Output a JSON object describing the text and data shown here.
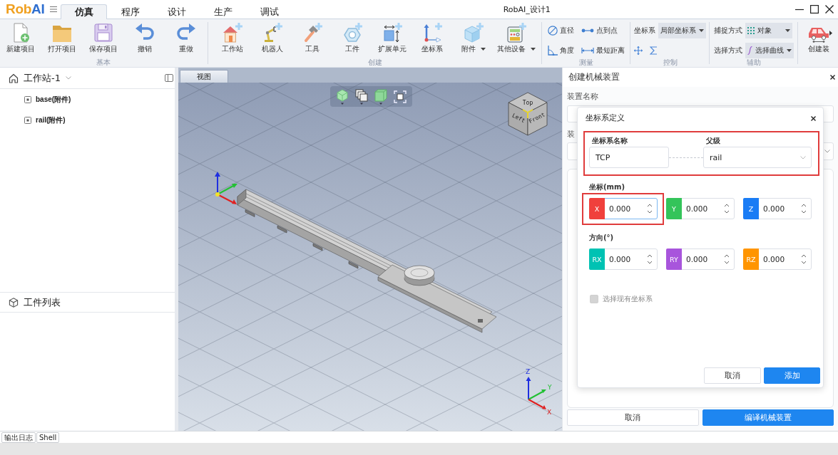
{
  "app": {
    "logo": [
      "Rob",
      "AI"
    ],
    "title": "RobAI_设计1"
  },
  "tabs": [
    {
      "label": "仿真",
      "selected": true
    },
    {
      "label": "程序",
      "selected": false
    },
    {
      "label": "设计",
      "selected": false
    },
    {
      "label": "生产",
      "selected": false
    },
    {
      "label": "调试",
      "selected": false
    }
  ],
  "ribbon": {
    "groups": [
      {
        "label": "基本",
        "items": [
          {
            "kind": "large",
            "label": "新建项目"
          },
          {
            "kind": "large",
            "label": "打开项目"
          },
          {
            "kind": "large",
            "label": "保存项目"
          },
          {
            "kind": "large",
            "label": "撤销"
          },
          {
            "kind": "large",
            "label": "重做"
          }
        ]
      },
      {
        "label": "创建",
        "items": [
          {
            "kind": "large",
            "label": "工作站"
          },
          {
            "kind": "large",
            "label": "机器人"
          },
          {
            "kind": "large",
            "label": "工具"
          },
          {
            "kind": "large",
            "label": "工件"
          },
          {
            "kind": "large",
            "label": "扩展单元"
          },
          {
            "kind": "large",
            "label": "坐标系"
          },
          {
            "kind": "large_menu",
            "label": "附件"
          },
          {
            "kind": "large_menu",
            "label": "其他设备"
          }
        ]
      },
      {
        "label": "测量",
        "items": [
          {
            "kind": "small",
            "label": "直径"
          },
          {
            "kind": "small",
            "label": "点到点"
          },
          {
            "kind": "small",
            "label": "角度"
          },
          {
            "kind": "small",
            "label": "最短距离"
          }
        ]
      },
      {
        "label": "控制",
        "items": [
          {
            "kind": "combo",
            "label": "坐标系",
            "value": "局部坐标系"
          },
          {
            "kind": "icon"
          },
          {
            "kind": "icon"
          }
        ]
      },
      {
        "label": "辅助",
        "items": [
          {
            "kind": "combo",
            "label": "捕捉方式",
            "value": "对象"
          },
          {
            "kind": "combo",
            "label": "选择方式",
            "value": "选择曲线"
          }
        ]
      },
      {
        "items": [
          {
            "kind": "large",
            "label": "创建装"
          }
        ]
      }
    ]
  },
  "workstation_panel": {
    "title": "工作站-1",
    "items": [
      {
        "label": "base(附件)"
      },
      {
        "label": "rail(附件)"
      }
    ]
  },
  "parts_panel": {
    "title": "工件列表"
  },
  "viewport": {
    "tab": "视图",
    "view_cube": [
      "Top",
      "Left",
      "Front"
    ],
    "axis_labels": [
      "Z",
      "Y",
      "X"
    ]
  },
  "device_panel": {
    "title": "创建机械装置",
    "name_label": "装置名称",
    "type_label": "装",
    "buttons": [
      {
        "kind": "secondary",
        "label": "取消"
      },
      {
        "kind": "primary",
        "label": "编译机械装置"
      }
    ]
  },
  "dialog": {
    "title": "坐标系定义",
    "identity": {
      "highlighted": true,
      "name_label": "坐标系名称",
      "name_value": "TCP",
      "parent_label": "父级",
      "parent_value": "rail"
    },
    "position_label": "坐标(mm)",
    "position": [
      {
        "axis": "X",
        "value": "0.000",
        "color": "#f0403c",
        "focused": true,
        "highlighted": true
      },
      {
        "axis": "Y",
        "value": "0.000",
        "color": "#34c45a",
        "focused": false,
        "highlighted": false
      },
      {
        "axis": "Z",
        "value": "0.000",
        "color": "#1a7cf5",
        "focused": false,
        "highlighted": false
      }
    ],
    "orientation_label": "方向(°)",
    "orientation": [
      {
        "axis": "RX",
        "value": "0.000",
        "color": "#00c2b3",
        "focused": false,
        "highlighted": false
      },
      {
        "axis": "RY",
        "value": "0.000",
        "color": "#a855dc",
        "focused": false,
        "highlighted": false
      },
      {
        "axis": "RZ",
        "value": "0.000",
        "color": "#ff9500",
        "focused": false,
        "highlighted": false
      }
    ],
    "checkbox": {
      "label": "选择现有坐标系",
      "checked": false,
      "disabled": true
    },
    "buttons": [
      {
        "kind": "secondary",
        "label": "取消"
      },
      {
        "kind": "primary",
        "label": "添加"
      }
    ]
  },
  "output_tabs": [
    "输出日志",
    "Shell"
  ]
}
